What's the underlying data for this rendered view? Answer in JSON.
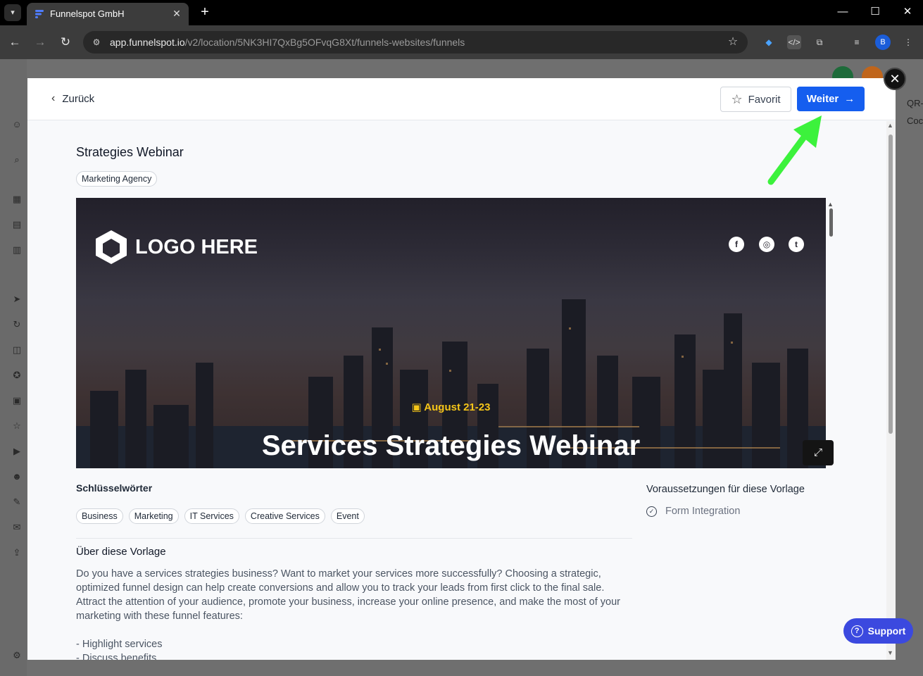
{
  "browser": {
    "tab_title": "Funnelspot GmbH",
    "tab_close": "✕",
    "new_tab": "+",
    "url_host": "app.funnelspot.io",
    "url_path": "/v2/location/5NK3HI7QxBg5OFvqG8Xt/funnels-websites/funnels",
    "profile_initial": "B",
    "window_controls": [
      "—",
      "☐",
      "✕"
    ]
  },
  "background_app": {
    "right_panel_lines": [
      "QR-",
      "Coc"
    ]
  },
  "modal": {
    "back_label": "Zurück",
    "favorite_label": "Favorit",
    "next_label": "Weiter",
    "close_symbol": "✕",
    "template": {
      "title": "Strategies Webinar",
      "category": "Marketing Agency",
      "preview": {
        "logo_text": "LOGO HERE",
        "social_icons": [
          "facebook-icon",
          "instagram-icon",
          "twitter-icon"
        ],
        "date": "August 21-23",
        "hero_title": "Services Strategies Webinar"
      }
    },
    "keywords": {
      "heading": "Schlüsselwörter",
      "items": [
        "Business",
        "Marketing",
        "IT Services",
        "Creative Services",
        "Event"
      ]
    },
    "about": {
      "heading": "Über diese Vorlage",
      "text": "Do you have a services strategies business? Want to market your services more successfully? Choosing a strategic, optimized funnel design can help create conversions and allow you to track your leads from first click to the final sale. Attract the attention of your audience, promote your business, increase your online presence, and make the most of your marketing with these funnel features:",
      "list": [
        "- Highlight services",
        "- Discuss benefits"
      ]
    },
    "requirements": {
      "heading": "Voraussetzungen für diese Vorlage",
      "items": [
        "Form Integration"
      ]
    }
  },
  "support": {
    "label": "Support"
  },
  "colors": {
    "accent": "#155eef",
    "support": "#3b49df",
    "date_highlight": "#f5c518",
    "annotation_arrow": "#3cf23c"
  }
}
